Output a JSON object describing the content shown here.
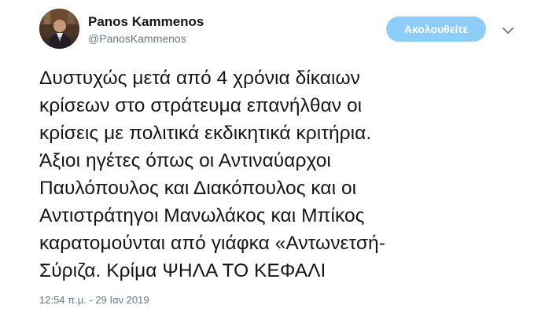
{
  "author": {
    "display_name": "Panos Kammenos",
    "handle": "@PanosKammenos"
  },
  "follow_button": {
    "label": "Ακολουθείτε"
  },
  "tweet": {
    "text": "Δυστυχώς μετά από 4 χρόνια δίκαιων\nκρίσεων στο στράτευμα επανήλθαν οι\nκρίσεις με πολιτικά εκδικητικά κριτήρια.\nΆξιοι ηγέτες όπως οι Αντιναύαρχοι\nΠαυλόπουλος και Διακόπουλος και οι\nΑντιστράτηγοι Μανωλάκος και Μπίκος\nκαρατομούνται από γιάφκα  «Αντωνετσή-\nΣύριζα. Κρίμα ΨΗΛΑ ΤΟ ΚΕΦΑΛΙ",
    "timestamp": "12:54 π.μ. - 29 Ιαν 2019"
  },
  "colors": {
    "follow_button_bg": "#8ecdf8",
    "secondary_text": "#657786",
    "primary_text": "#14171a"
  },
  "icons": {
    "menu": "chevron-down-icon"
  }
}
